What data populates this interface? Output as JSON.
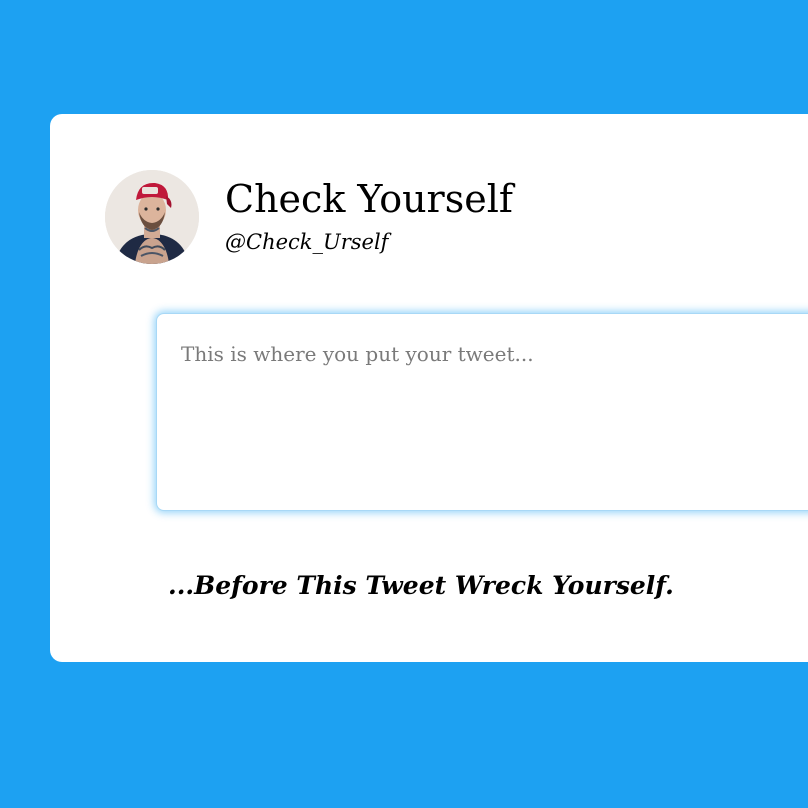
{
  "profile": {
    "display_name": "Check Yourself",
    "handle": "@Check_Urself",
    "avatar_icon": "profile-photo-avatar"
  },
  "composer": {
    "placeholder": "This is where you put your tweet...",
    "value": ""
  },
  "tagline": "...Before This Tweet Wreck Yourself.",
  "colors": {
    "background": "#1da1f2",
    "card": "#ffffff",
    "input_glow": "#1da1f2",
    "text": "#000000",
    "placeholder": "#7a7a7a"
  }
}
